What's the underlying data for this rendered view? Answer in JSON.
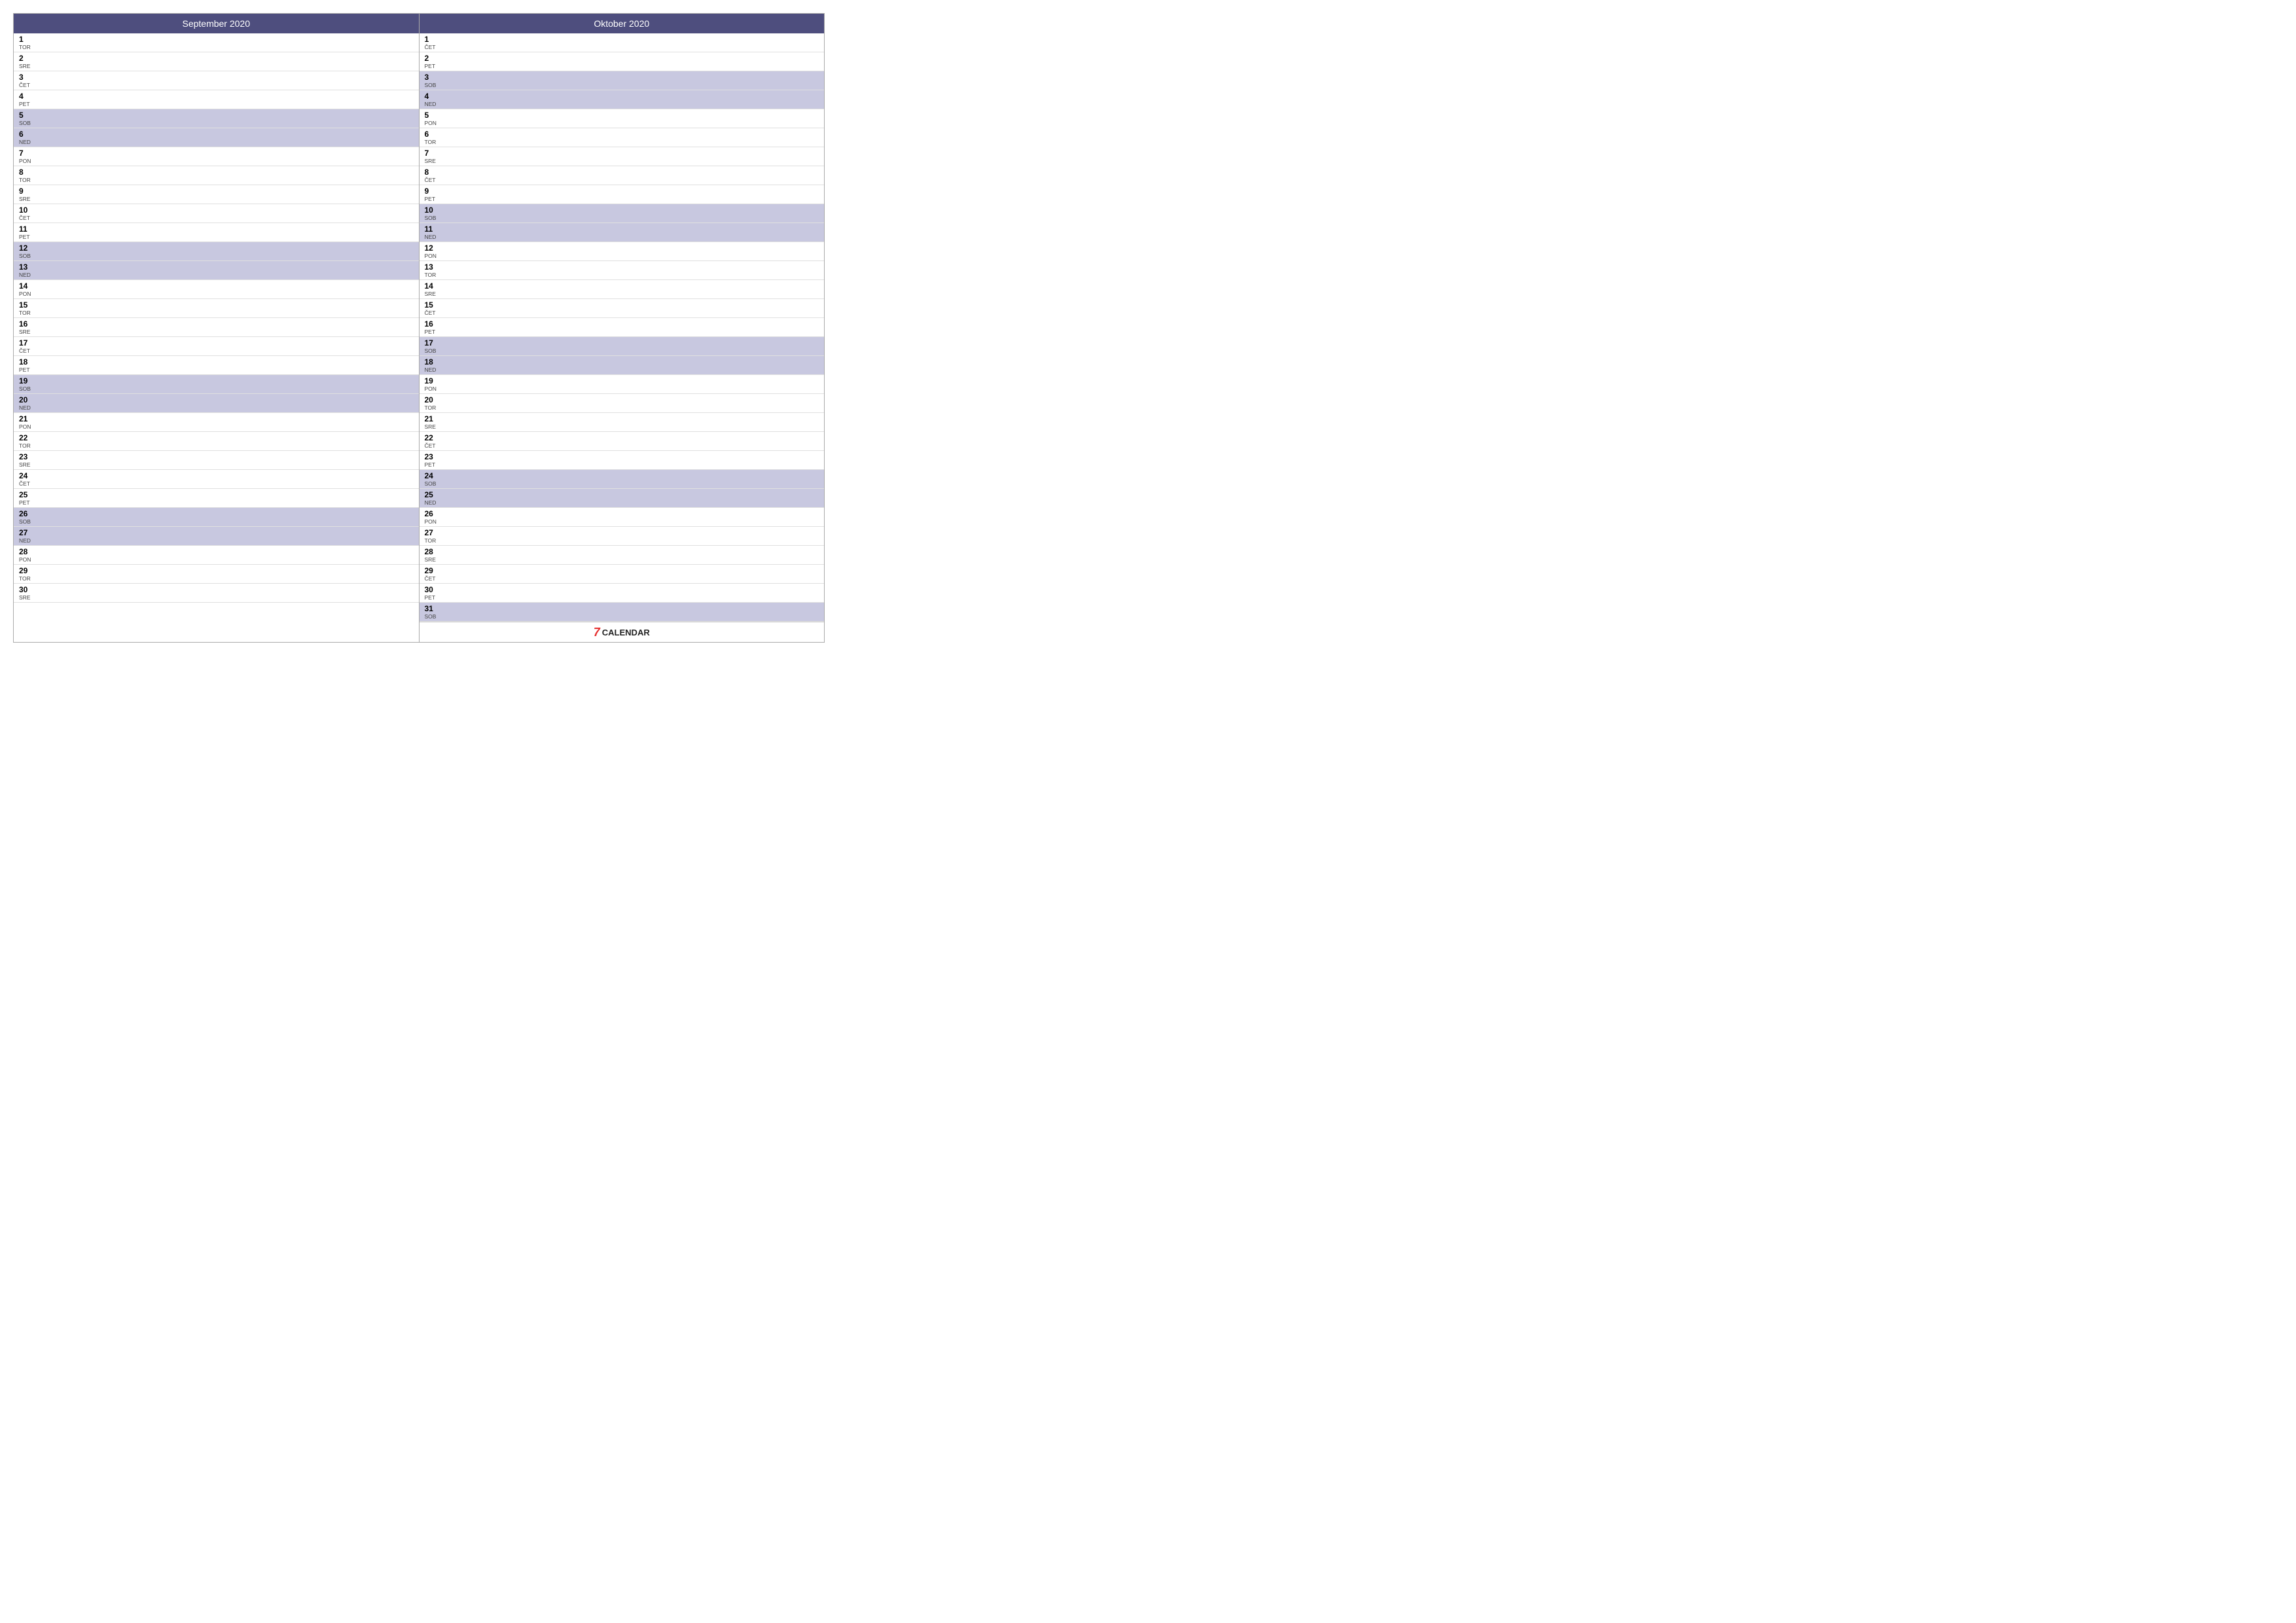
{
  "months": [
    {
      "title": "September 2020",
      "days": [
        {
          "num": "1",
          "label": "TOR",
          "type": "weekday"
        },
        {
          "num": "2",
          "label": "SRE",
          "type": "weekday"
        },
        {
          "num": "3",
          "label": "ČET",
          "type": "weekday"
        },
        {
          "num": "4",
          "label": "PET",
          "type": "weekday"
        },
        {
          "num": "5",
          "label": "SOB",
          "type": "weekend"
        },
        {
          "num": "6",
          "label": "NED",
          "type": "weekend"
        },
        {
          "num": "7",
          "label": "PON",
          "type": "weekday"
        },
        {
          "num": "8",
          "label": "TOR",
          "type": "weekday"
        },
        {
          "num": "9",
          "label": "SRE",
          "type": "weekday"
        },
        {
          "num": "10",
          "label": "ČET",
          "type": "weekday"
        },
        {
          "num": "11",
          "label": "PET",
          "type": "weekday"
        },
        {
          "num": "12",
          "label": "SOB",
          "type": "weekend"
        },
        {
          "num": "13",
          "label": "NED",
          "type": "weekend"
        },
        {
          "num": "14",
          "label": "PON",
          "type": "weekday"
        },
        {
          "num": "15",
          "label": "TOR",
          "type": "weekday"
        },
        {
          "num": "16",
          "label": "SRE",
          "type": "weekday"
        },
        {
          "num": "17",
          "label": "ČET",
          "type": "weekday"
        },
        {
          "num": "18",
          "label": "PET",
          "type": "weekday"
        },
        {
          "num": "19",
          "label": "SOB",
          "type": "weekend"
        },
        {
          "num": "20",
          "label": "NED",
          "type": "weekend"
        },
        {
          "num": "21",
          "label": "PON",
          "type": "weekday"
        },
        {
          "num": "22",
          "label": "TOR",
          "type": "weekday"
        },
        {
          "num": "23",
          "label": "SRE",
          "type": "weekday"
        },
        {
          "num": "24",
          "label": "ČET",
          "type": "weekday"
        },
        {
          "num": "25",
          "label": "PET",
          "type": "weekday"
        },
        {
          "num": "26",
          "label": "SOB",
          "type": "weekend"
        },
        {
          "num": "27",
          "label": "NED",
          "type": "weekend"
        },
        {
          "num": "28",
          "label": "PON",
          "type": "weekday"
        },
        {
          "num": "29",
          "label": "TOR",
          "type": "weekday"
        },
        {
          "num": "30",
          "label": "SRE",
          "type": "weekday"
        }
      ]
    },
    {
      "title": "Oktober 2020",
      "days": [
        {
          "num": "1",
          "label": "ČET",
          "type": "weekday"
        },
        {
          "num": "2",
          "label": "PET",
          "type": "weekday"
        },
        {
          "num": "3",
          "label": "SOB",
          "type": "weekend"
        },
        {
          "num": "4",
          "label": "NED",
          "type": "weekend"
        },
        {
          "num": "5",
          "label": "PON",
          "type": "weekday"
        },
        {
          "num": "6",
          "label": "TOR",
          "type": "weekday"
        },
        {
          "num": "7",
          "label": "SRE",
          "type": "weekday"
        },
        {
          "num": "8",
          "label": "ČET",
          "type": "weekday"
        },
        {
          "num": "9",
          "label": "PET",
          "type": "weekday"
        },
        {
          "num": "10",
          "label": "SOB",
          "type": "weekend"
        },
        {
          "num": "11",
          "label": "NED",
          "type": "weekend"
        },
        {
          "num": "12",
          "label": "PON",
          "type": "weekday"
        },
        {
          "num": "13",
          "label": "TOR",
          "type": "weekday"
        },
        {
          "num": "14",
          "label": "SRE",
          "type": "weekday"
        },
        {
          "num": "15",
          "label": "ČET",
          "type": "weekday"
        },
        {
          "num": "16",
          "label": "PET",
          "type": "weekday"
        },
        {
          "num": "17",
          "label": "SOB",
          "type": "weekend"
        },
        {
          "num": "18",
          "label": "NED",
          "type": "weekend"
        },
        {
          "num": "19",
          "label": "PON",
          "type": "weekday"
        },
        {
          "num": "20",
          "label": "TOR",
          "type": "weekday"
        },
        {
          "num": "21",
          "label": "SRE",
          "type": "weekday"
        },
        {
          "num": "22",
          "label": "ČET",
          "type": "weekday"
        },
        {
          "num": "23",
          "label": "PET",
          "type": "weekday"
        },
        {
          "num": "24",
          "label": "SOB",
          "type": "weekend"
        },
        {
          "num": "25",
          "label": "NED",
          "type": "weekend"
        },
        {
          "num": "26",
          "label": "PON",
          "type": "weekday"
        },
        {
          "num": "27",
          "label": "TOR",
          "type": "weekday"
        },
        {
          "num": "28",
          "label": "SRE",
          "type": "weekday"
        },
        {
          "num": "29",
          "label": "ČET",
          "type": "weekday"
        },
        {
          "num": "30",
          "label": "PET",
          "type": "weekday"
        },
        {
          "num": "31",
          "label": "SOB",
          "type": "weekend"
        }
      ]
    }
  ],
  "footer": {
    "icon": "7",
    "label": "CALENDAR"
  }
}
